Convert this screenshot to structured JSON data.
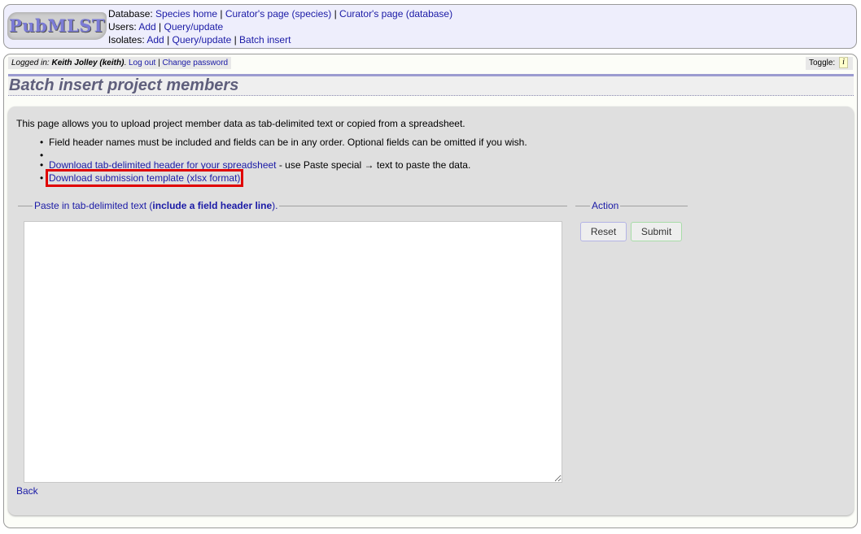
{
  "header": {
    "logo_text": "PubMLST",
    "nav": [
      {
        "label": "Database:",
        "links": [
          "Species home",
          "Curator's page (species)",
          "Curator's page (database)"
        ]
      },
      {
        "label": "Users:",
        "links": [
          "Add",
          "Query/update"
        ]
      },
      {
        "label": "Isolates:",
        "links": [
          "Add",
          "Query/update",
          "Batch insert"
        ]
      }
    ]
  },
  "login_bar": {
    "prefix": "Logged in:",
    "user": "Keith Jolley (keith)",
    "logout": "Log out",
    "change_password": "Change password"
  },
  "toggle": {
    "label": "Toggle:",
    "icon": "info-icon",
    "icon_glyph": "i"
  },
  "page_title": "Batch insert project members",
  "content": {
    "intro": "This page allows you to upload project member data as tab-delimited text or copied from a spreadsheet.",
    "bullets": {
      "field_note": "Field header names must be included and fields can be in any order. Optional fields can be omitted if you wish.",
      "download_header_link": "Download tab-delimited header for your spreadsheet",
      "download_header_suffix": " - use Paste special → text to paste the data.",
      "download_template_link": "Download submission template (xlsx format)"
    },
    "paste_fieldset": {
      "legend_prefix": "Paste in tab-delimited text (",
      "legend_bold": "include a field header line",
      "legend_suffix": ").",
      "textarea_value": ""
    },
    "action_fieldset": {
      "legend": "Action",
      "reset_label": "Reset",
      "submit_label": "Submit"
    },
    "back_link": "Back"
  },
  "colors": {
    "link": "#1a1aa6",
    "header_bg": "#eeeefc",
    "content_bg": "#dfdfdf",
    "title_color": "#5f5f7c",
    "highlight": "#e00000"
  }
}
